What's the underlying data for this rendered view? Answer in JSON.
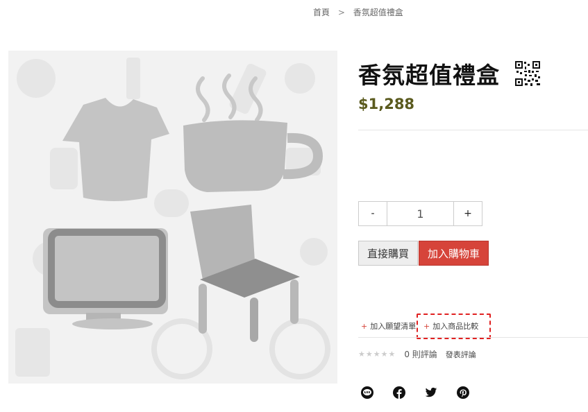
{
  "breadcrumb": {
    "home": "首頁",
    "separator": ">",
    "current": "香氛超值禮盒"
  },
  "product": {
    "title": "香氛超值禮盒",
    "price": "$1,288",
    "quantity": "1"
  },
  "quantity_controls": {
    "decrease_label": "-",
    "increase_label": "+"
  },
  "actions": {
    "buy_now_label": "直接購買",
    "add_to_cart_label": "加入購物車",
    "wishlist_label": "加入願望清單",
    "compare_label": "加入商品比較",
    "plus_sign": "+"
  },
  "reviews": {
    "stars": "★★★★★",
    "rating": 0,
    "count_text": "0 則評論",
    "write_review_label": "發表評論"
  },
  "social": [
    {
      "icon": "line-icon"
    },
    {
      "icon": "facebook-icon"
    },
    {
      "icon": "twitter-icon"
    },
    {
      "icon": "pinterest-icon"
    }
  ],
  "colors": {
    "accent_red": "#d6443a",
    "price_color": "#5a5a1e",
    "highlight_border": "#e02020"
  }
}
